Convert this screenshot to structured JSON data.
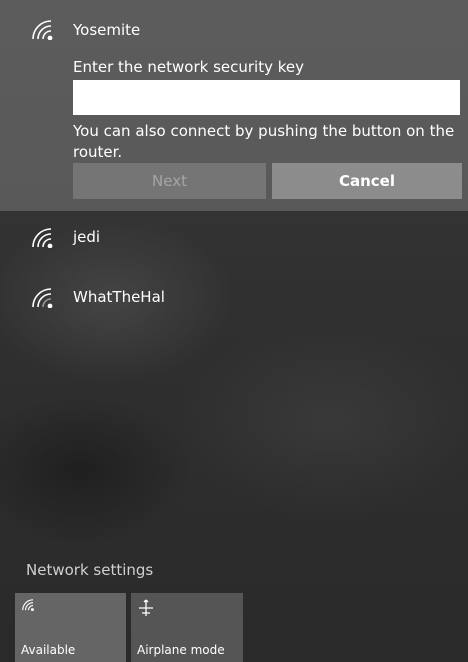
{
  "networks": [
    {
      "name": "Yosemite",
      "icon": "wifi-signal-icon"
    },
    {
      "name": "jedi",
      "icon": "wifi-signal-icon"
    },
    {
      "name": "WhatTheHal",
      "icon": "wifi-signal-icon"
    }
  ],
  "connect_form": {
    "prompt": "Enter the network security key",
    "key_value": "",
    "hint": "You can also connect by pushing the button on the router.",
    "next_label": "Next",
    "cancel_label": "Cancel"
  },
  "settings_link": "Network settings",
  "quick_actions": [
    {
      "label": "Available",
      "icon": "wifi-signal-icon"
    },
    {
      "label": "Airplane mode",
      "icon": "airplane-icon"
    }
  ]
}
